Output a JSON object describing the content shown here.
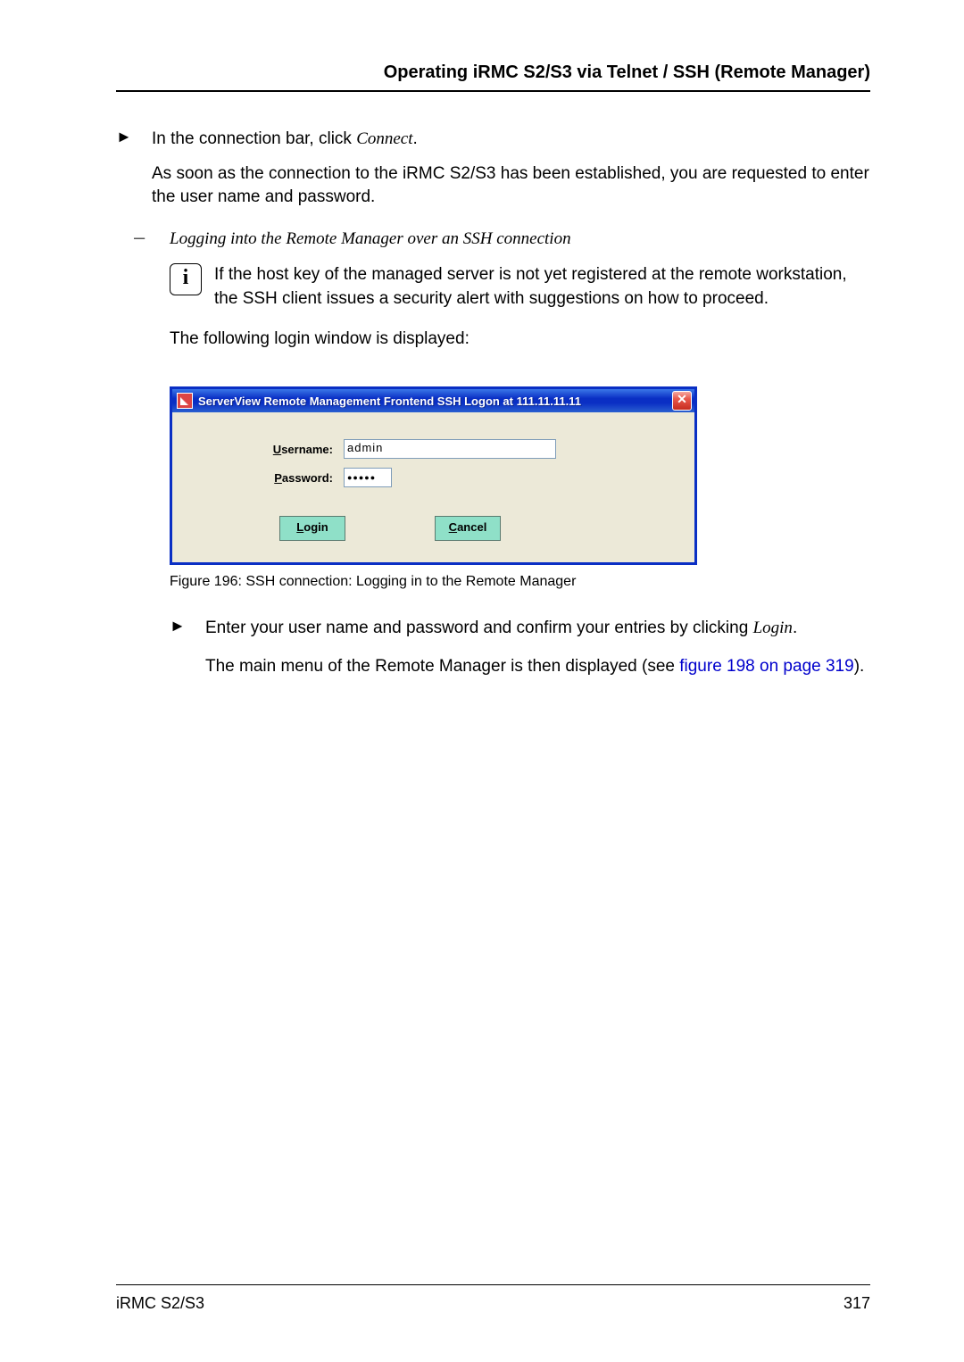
{
  "header": {
    "title": "Operating iRMC S2/S3 via Telnet / SSH (Remote Manager)"
  },
  "body": {
    "bullet1_prefix": "In the connection bar, click ",
    "bullet1_italic": "Connect",
    "bullet1_suffix": ".",
    "para1": "As soon as the connection to the iRMC S2/S3 has been established, you are requested to enter the user name and password.",
    "subheading": "Logging into the Remote Manager over an SSH connection",
    "info_text": "If the host key of the managed server is not yet registered at the remote workstation, the SSH client issues a security alert with suggestions on how to proceed.",
    "following": "The following login window is displayed:",
    "bullet2_prefix": "Enter your user name and password and confirm your entries by clicking ",
    "bullet2_italic": "Login",
    "bullet2_suffix": ".",
    "para3_prefix": "The main menu of the Remote Manager is then displayed (see ",
    "para3_link": "figure 198 on page 319",
    "para3_suffix": ")."
  },
  "dialog": {
    "title": "ServerView Remote Management Frontend SSH Logon at 111.11.11.11",
    "username_label_rest": "sername:",
    "password_label_rest": "assword:",
    "username_value": "admin",
    "password_value": "●●●●●",
    "login_rest": "ogin",
    "cancel_rest": "ancel"
  },
  "figure": {
    "caption": "Figure 196: SSH connection: Logging in to the Remote Manager"
  },
  "footer": {
    "left": "iRMC S2/S3",
    "right": "317"
  }
}
